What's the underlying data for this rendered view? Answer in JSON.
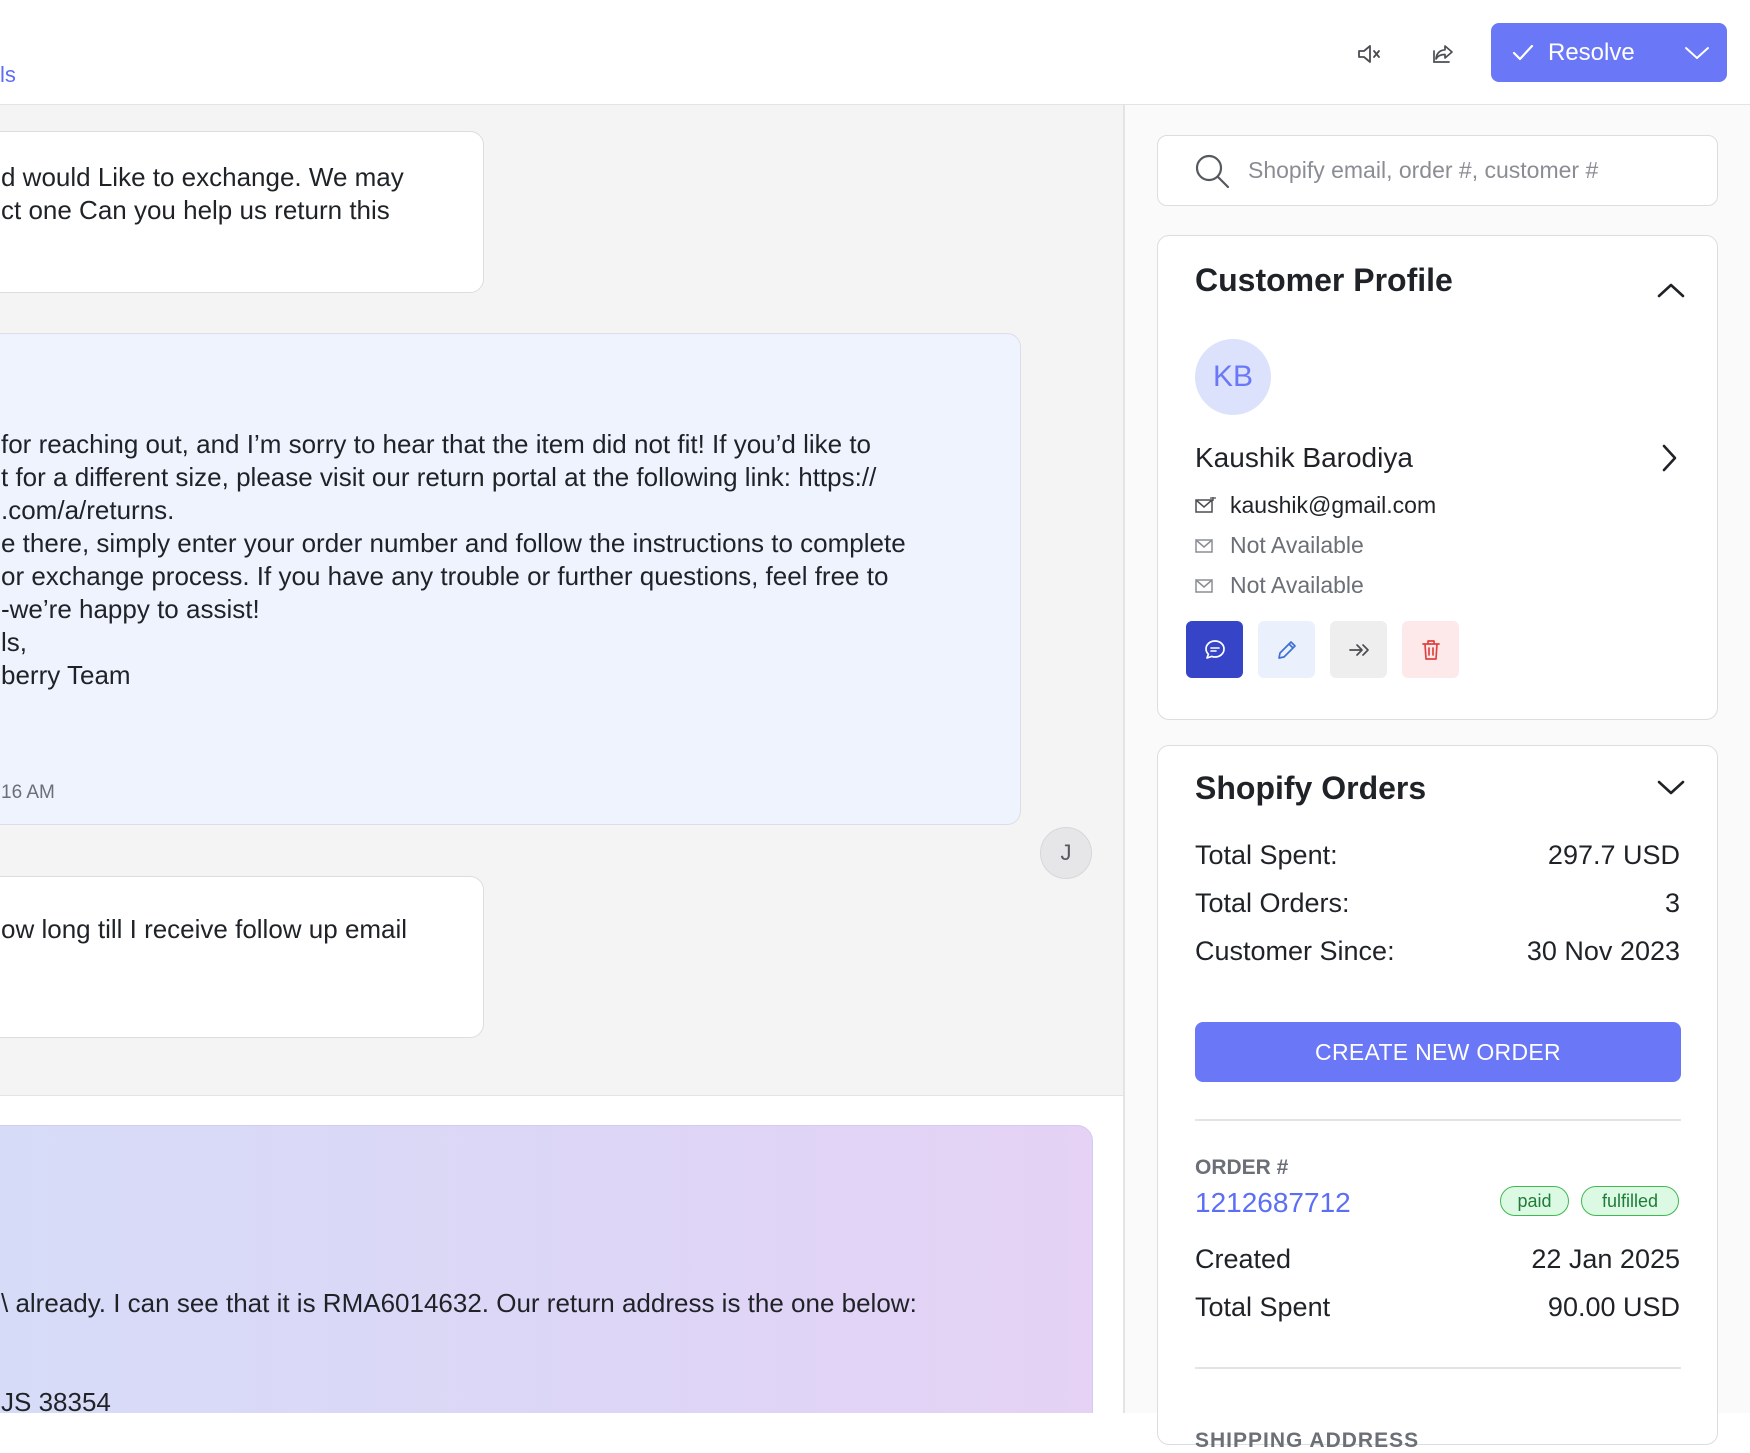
{
  "header": {
    "tab_fragment": "ls",
    "resolve_label": "Resolve",
    "icons": [
      "mute-icon",
      "share-icon",
      "check-icon",
      "chevron-down-icon"
    ]
  },
  "messages": [
    {
      "lines": [
        "d would Like to exchange. We may",
        "ct one Can you help us return this"
      ]
    },
    {
      "lines": [
        "for reaching out, and I’m sorry to hear that the item did not fit! If you’d like to",
        "t for a different size, please visit our return portal at the following link: https://",
        ".com/a/returns.",
        "e there, simply enter your order number and follow the instructions to complete",
        "or exchange process. If you have any trouble or further questions, feel free to",
        "-we’re happy to assist!",
        "",
        "ls,",
        "",
        "berry Team"
      ],
      "time": "16 AM"
    },
    {
      "lines": [
        "ow long till I receive follow up email"
      ]
    }
  ],
  "agent_avatar": "J",
  "ai_suggestion": {
    "lines": [
      "\\ already. I can see that it is RMA6014632. Our return address is the one below:",
      "JS 38354"
    ]
  },
  "search": {
    "placeholder": "Shopify email, order #, customer #"
  },
  "profile": {
    "title": "Customer Profile",
    "initials": "KB",
    "name": "Kaushik Barodiya",
    "email": "kaushik@gmail.com",
    "contact_2": "Not Available",
    "contact_3": "Not Available"
  },
  "orders": {
    "title": "Shopify Orders",
    "total_spent_label": "Total Spent:",
    "total_spent": "297.7 USD",
    "total_orders_label": "Total Orders:",
    "total_orders": "3",
    "customer_since_label": "Customer Since:",
    "customer_since": "30 Nov 2023",
    "create_button": "CREATE NEW ORDER",
    "order_label": "ORDER #",
    "order_number": "1212687712",
    "badge_paid": "paid",
    "badge_fulfilled": "fulfilled",
    "created_label": "Created",
    "created": "22 Jan 2025",
    "order_total_label": "Total Spent",
    "order_total": "90.00 USD",
    "shipping_label": "SHIPPING ADDRESS"
  },
  "colors": {
    "accent": "#6a78f7",
    "link": "#5b6ef5",
    "dark_accent": "#3644c7",
    "badge_green": "#3fb950"
  }
}
